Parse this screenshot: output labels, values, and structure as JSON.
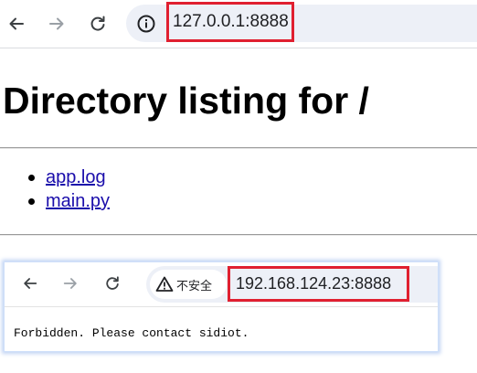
{
  "top_browser": {
    "url": "127.0.0.1:8888",
    "icons": {
      "back": "arrow-left-icon",
      "forward": "arrow-right-icon",
      "reload": "reload-icon",
      "site_info": "info-icon"
    }
  },
  "page": {
    "title": "Directory listing for /",
    "files": [
      {
        "name": "app.log"
      },
      {
        "name": "main.py"
      }
    ]
  },
  "inset_browser": {
    "security_label": "不安全",
    "url": "192.168.124.23:8888",
    "body_text": "Forbidden. Please contact sidiot.",
    "icons": {
      "back": "arrow-left-icon",
      "forward": "arrow-right-icon",
      "reload": "reload-icon",
      "security": "warning-triangle-icon"
    }
  },
  "colors": {
    "highlight": "#e02030",
    "link": "#1a0dab",
    "omnibox_bg": "#edf0f7"
  }
}
